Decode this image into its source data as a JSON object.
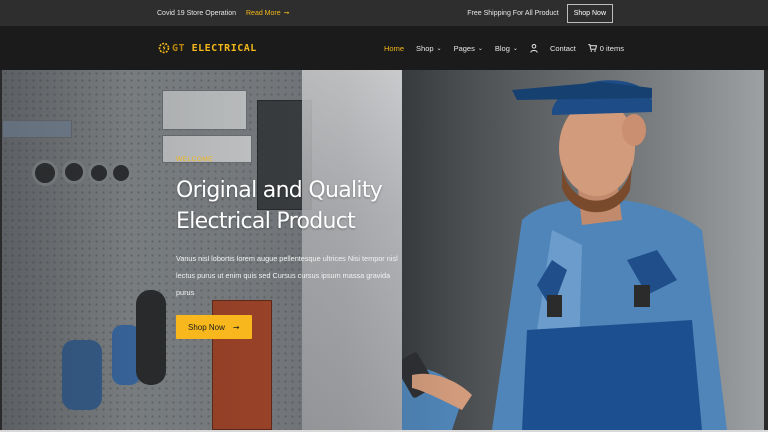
{
  "topbar": {
    "notice": "Covid 19 Store Operation",
    "read_more": "Read More",
    "read_more_arrow": "➞",
    "shipping": "Free Shipping For All Product",
    "shop_now": "Shop Now"
  },
  "brand": {
    "logo_icon": "gear-bolt-icon",
    "prefix": "GT",
    "name": "ELECTRICAL"
  },
  "nav": {
    "items": [
      {
        "label": "Home",
        "active": true
      },
      {
        "label": "Shop",
        "dropdown": true
      },
      {
        "label": "Pages",
        "dropdown": true
      },
      {
        "label": "Blog",
        "dropdown": true
      },
      {
        "label": "",
        "icon": "user-icon"
      },
      {
        "label": "Contact"
      },
      {
        "label": "0 items",
        "icon": "cart-icon"
      }
    ],
    "chevron": "⌄"
  },
  "hero": {
    "eyebrow": "WELCOME",
    "headline_line1": "Original and Quality",
    "headline_line2": "Electrical Product",
    "description": "Varius nisl lobortis lorem augue pellentesque ultrices Nisi tempor nisl lectus purus ut enim quis sed Cursus cursus ipsum massa gravida purus",
    "cta": "Shop Now",
    "cta_arrow": "➞"
  },
  "colors": {
    "accent": "#f2b81a",
    "topbar": "#2e2e2e",
    "navbar": "#1b1b1b"
  }
}
